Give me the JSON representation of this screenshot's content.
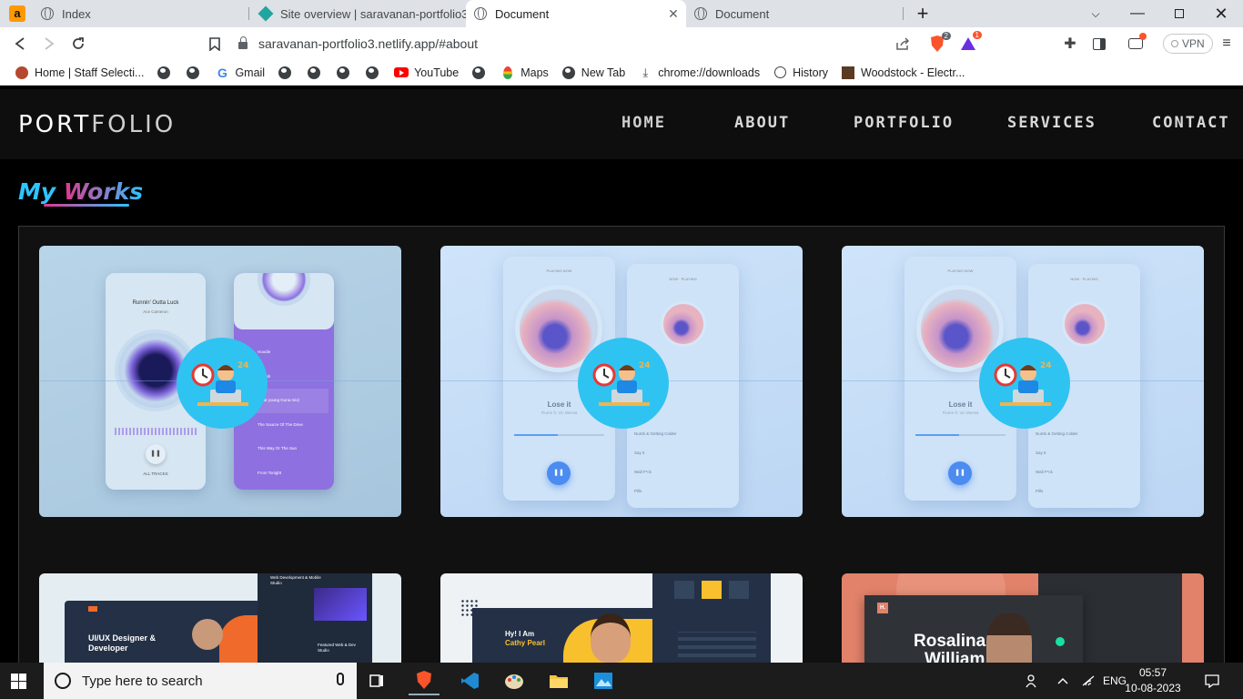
{
  "browser": {
    "tabs": [
      {
        "title": "Index",
        "active": false
      },
      {
        "title": "Site overview | saravanan-portfolio3 | N",
        "active": false
      },
      {
        "title": "Document",
        "active": true
      },
      {
        "title": "Document",
        "active": false
      }
    ],
    "new_tab": "+",
    "url": "saravanan-portfolio3.netlify.app/#about",
    "vpn_label": "VPN",
    "brave_badge": "2",
    "rewards_badge": "1",
    "bookmarks": [
      {
        "label": "Home | Staff Selecti...",
        "icon": "staff-selection-icon"
      },
      {
        "label": "",
        "icon": "globe-icon"
      },
      {
        "label": "",
        "icon": "globe-icon"
      },
      {
        "label": "Gmail",
        "icon": "google-icon"
      },
      {
        "label": "",
        "icon": "globe-icon"
      },
      {
        "label": "",
        "icon": "globe-icon"
      },
      {
        "label": "",
        "icon": "globe-icon"
      },
      {
        "label": "",
        "icon": "globe-icon"
      },
      {
        "label": "YouTube",
        "icon": "youtube-icon"
      },
      {
        "label": "",
        "icon": "globe-icon"
      },
      {
        "label": "Maps",
        "icon": "maps-icon"
      },
      {
        "label": "New Tab",
        "icon": "globe-icon"
      },
      {
        "label": "chrome://downloads",
        "icon": "download-icon"
      },
      {
        "label": "History",
        "icon": "history-icon"
      },
      {
        "label": "Woodstock - Electr...",
        "icon": "woodstock-icon"
      }
    ]
  },
  "site": {
    "logo_a": "PORT",
    "logo_b": "FOLIO",
    "nav": [
      "HOME",
      "ABOUT",
      "PORTFOLIO",
      "SERVICES",
      "CONTACT"
    ],
    "heading_a": "My",
    "heading_b": "Works"
  },
  "cards": {
    "c1": {
      "song": "Runnin' Outta Luck",
      "artist": "Ace Cameron",
      "list": [
        "Hoodie",
        "Kaatah",
        "(Feat young Guna mix)",
        "The Source Of The Drive",
        "This Way Or The Sun",
        "From Tonight"
      ],
      "now_playing": "ALL TRACKS"
    },
    "c2": {
      "header": "PLAYING NOW",
      "right_header": "NOW · PLAYING",
      "song": "Lose it",
      "artist": "Flume ft. Vic Mensa",
      "list": [
        "Numb & Getting Colder",
        "Say It",
        "Wall F*ck",
        "Pills"
      ]
    },
    "c3": {
      "header": "PLAYING NOW",
      "right_header": "NOW · PLAYING",
      "song": "Lose it",
      "artist": "Flume ft. Vic Mensa",
      "list": [
        "Numb & Getting Colder",
        "Say It",
        "Wall F*ck",
        "Pills"
      ]
    },
    "c4": {
      "title": "UI/UX Designer & Developer",
      "side": "Web Development & Mobile Studio",
      "side2": "Featured Web & Dev Studio"
    },
    "c5": {
      "hello": "Hy! I Am",
      "name": "Cathy Pearl"
    },
    "c6": {
      "name": "Rosalina",
      "name2": "William",
      "logo": "H."
    }
  },
  "taskbar": {
    "search_placeholder": "Type here to search",
    "lang": "ENG",
    "time": "05:57",
    "date": "10-08-2023"
  }
}
